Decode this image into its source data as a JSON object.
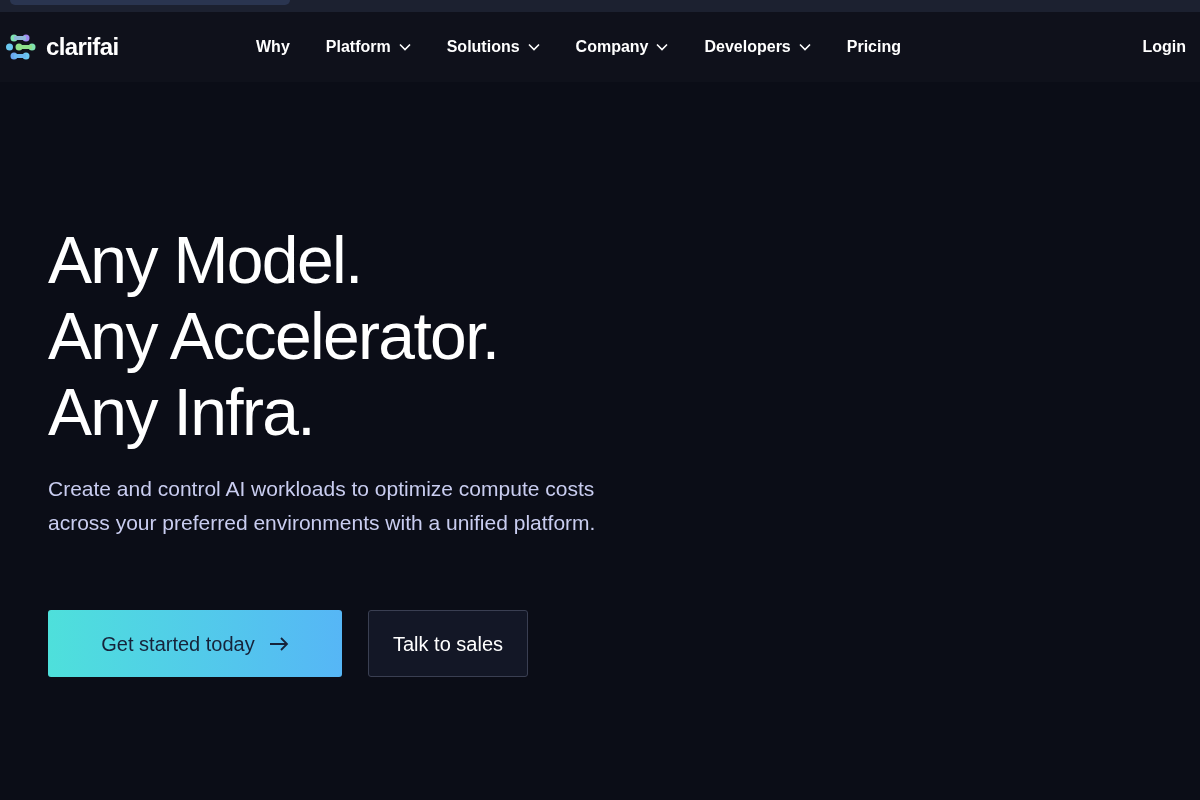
{
  "logo": {
    "text": "clarifai"
  },
  "nav": [
    {
      "label": "Why",
      "has_menu": false
    },
    {
      "label": "Platform",
      "has_menu": true
    },
    {
      "label": "Solutions",
      "has_menu": true
    },
    {
      "label": "Company",
      "has_menu": true
    },
    {
      "label": "Developers",
      "has_menu": true
    },
    {
      "label": "Pricing",
      "has_menu": false
    }
  ],
  "login": "Login",
  "hero": {
    "headline": [
      "Any Model.",
      "Any Accelerator.",
      "Any Infra."
    ],
    "subtitle": "Create and control AI workloads to optimize compute costs across your preferred environments with a unified platform.",
    "buttons": [
      {
        "label": "Get started today",
        "kind": "primary"
      },
      {
        "label": "Talk to sales",
        "kind": "secondary"
      }
    ]
  }
}
